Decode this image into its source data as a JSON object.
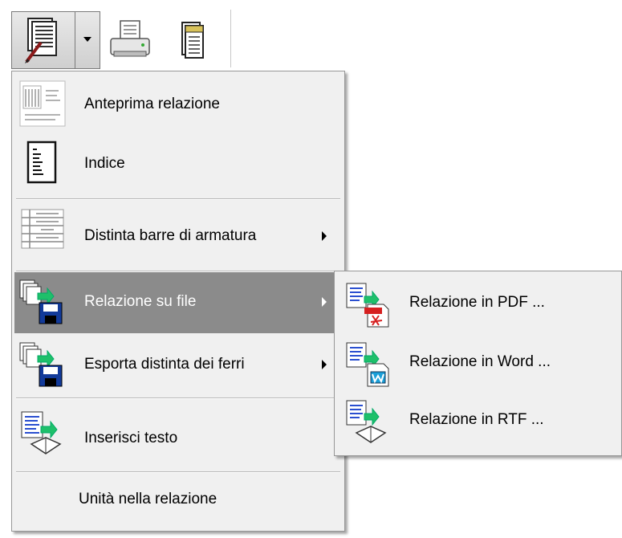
{
  "toolbar": {
    "buttons": [
      {
        "name": "relazione-split-button",
        "icon": "report-edit-icon"
      },
      {
        "name": "dropdown-arrow",
        "icon": "chevron-down-icon"
      },
      {
        "name": "print-button",
        "icon": "printer-icon"
      },
      {
        "name": "document-button",
        "icon": "document-icon"
      }
    ]
  },
  "menu": {
    "items": [
      {
        "label": "Anteprima relazione",
        "icon": "report-preview-icon",
        "has_submenu": false
      },
      {
        "label": "Indice",
        "icon": "index-icon",
        "has_submenu": false
      },
      {
        "label": "Distinta barre di armatura",
        "icon": "rebar-list-icon",
        "has_submenu": true
      },
      {
        "label": "Relazione su file",
        "icon": "export-to-file-icon",
        "has_submenu": true,
        "highlighted": true
      },
      {
        "label": "Esporta distinta dei ferri",
        "icon": "export-rebar-icon",
        "has_submenu": true
      },
      {
        "label": "Inserisci testo",
        "icon": "insert-text-icon",
        "has_submenu": false
      },
      {
        "label": "Unità nella relazione",
        "icon": "",
        "has_submenu": false
      }
    ]
  },
  "submenu": {
    "items": [
      {
        "label": "Relazione in PDF ...",
        "icon": "pdf-export-icon"
      },
      {
        "label": "Relazione in Word ...",
        "icon": "word-export-icon"
      },
      {
        "label": "Relazione in RTF ...",
        "icon": "rtf-export-icon"
      }
    ]
  },
  "colors": {
    "menu_bg": "#f0f0f0",
    "highlight_bg": "#8b8b8b",
    "highlight_text": "#ffffff",
    "border": "#979797"
  }
}
